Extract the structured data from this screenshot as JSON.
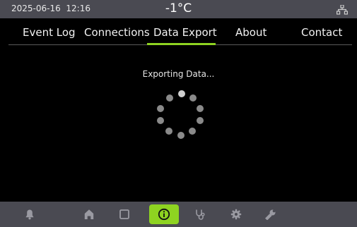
{
  "status": {
    "date": "2025-06-16",
    "time": "12:16",
    "temperature": "-1°C",
    "network_icon": "network-icon"
  },
  "tabs": [
    {
      "label": "Event Log",
      "active": false
    },
    {
      "label": "Connections",
      "active": false
    },
    {
      "label": "Data Export",
      "active": true
    },
    {
      "label": "About",
      "active": false
    },
    {
      "label": "Contact",
      "active": false
    }
  ],
  "main": {
    "message": "Exporting Data..."
  },
  "bottom_nav": [
    {
      "icon": "bell-icon"
    },
    {
      "icon": "home-icon"
    },
    {
      "icon": "square-icon"
    },
    {
      "icon": "info-icon",
      "active": true
    },
    {
      "icon": "stethoscope-icon"
    },
    {
      "icon": "gear-icon"
    },
    {
      "icon": "wrench-icon"
    }
  ],
  "colors": {
    "accent": "#8ed321",
    "bar_background": "#4a4a52",
    "icon_gray": "#9a9aa2"
  }
}
